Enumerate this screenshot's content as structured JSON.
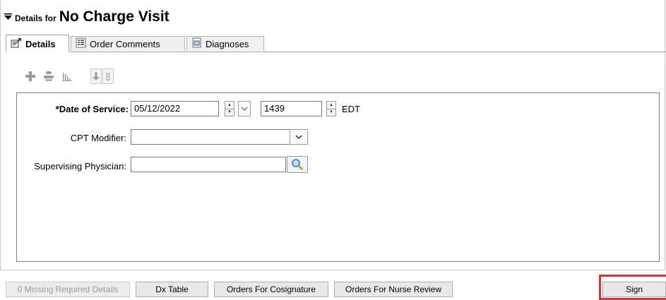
{
  "header": {
    "collapse_icon": "collapse-triangle-icon",
    "prefix": "Details for",
    "title": "No Charge Visit"
  },
  "tabs": [
    {
      "label": "Details",
      "icon": "details-icon",
      "active": true
    },
    {
      "label": "Order Comments",
      "icon": "comments-icon",
      "active": false
    },
    {
      "label": "Diagnoses",
      "icon": "diagnoses-icon",
      "active": false
    }
  ],
  "toolbar": {
    "icons": [
      "add-icon",
      "remove-icon",
      "chart-icon",
      "move-down-icon",
      "move-down-all-icon"
    ]
  },
  "form": {
    "date_of_service": {
      "label": "*Date of Service:",
      "date_value": "05/12/2022",
      "time_value": "1439",
      "timezone": "EDT"
    },
    "cpt_modifier": {
      "label": "CPT Modifier:",
      "value": ""
    },
    "supervising_physician": {
      "label": "Supervising Physician:",
      "value": ""
    }
  },
  "footer": {
    "missing_details": "0 Missing Required Details",
    "dx_table": "Dx Table",
    "orders_cosignature": "Orders For Cosignature",
    "orders_nurse_review": "Orders For Nurse Review",
    "sign": "Sign"
  },
  "colors": {
    "highlight": "#e03030",
    "field_border": "#7a7a7a"
  }
}
